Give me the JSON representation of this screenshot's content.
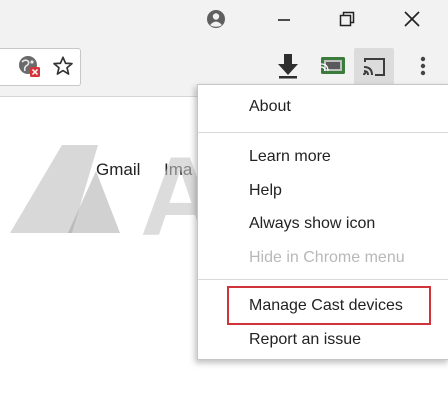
{
  "window": {
    "icons": [
      "account-icon",
      "minimize-icon",
      "restore-icon",
      "close-icon"
    ]
  },
  "toolbar": {
    "icons": [
      "site-info-icon",
      "bookmark-star-icon",
      "download-icon",
      "cast-extension-icon",
      "cast-icon",
      "more-icon"
    ]
  },
  "page": {
    "links": [
      "Gmail",
      "Ima"
    ]
  },
  "watermark": {
    "text": "Alphr"
  },
  "menu": {
    "items": [
      {
        "label": "About",
        "enabled": true
      },
      {
        "label": "Learn more",
        "enabled": true
      },
      {
        "label": "Help",
        "enabled": true
      },
      {
        "label": "Always show icon",
        "enabled": true
      },
      {
        "label": "Hide in Chrome menu",
        "enabled": false
      },
      {
        "label": "Manage Cast devices",
        "enabled": true,
        "highlighted": true
      },
      {
        "label": "Report an issue",
        "enabled": true
      }
    ]
  },
  "colors": {
    "highlight": "#d0343a",
    "toolbar": "#f2f2f2"
  }
}
